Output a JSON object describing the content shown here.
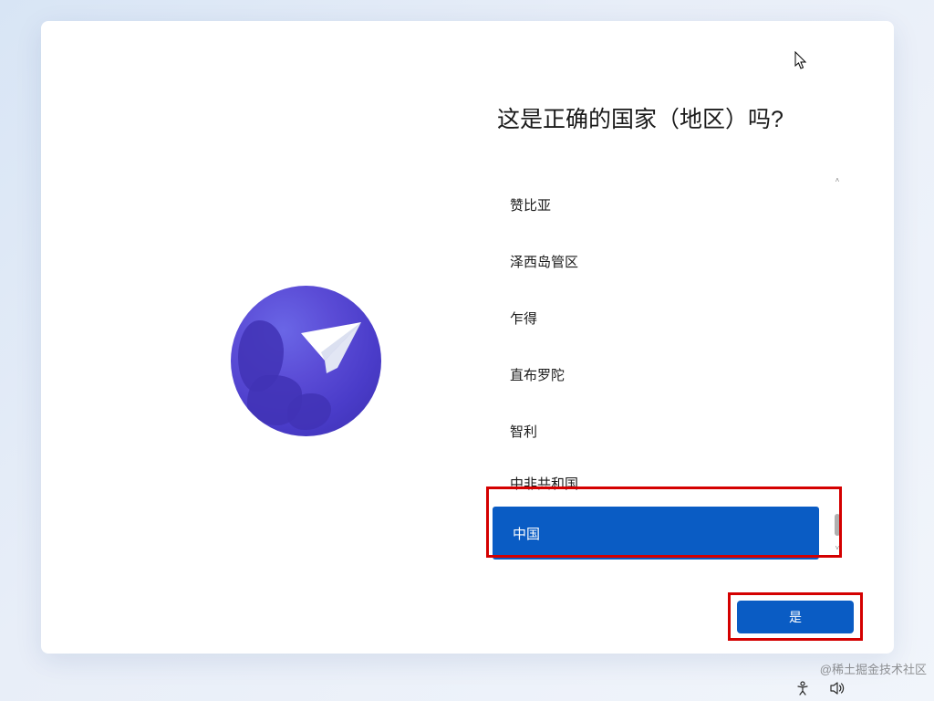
{
  "title": "这是正确的国家（地区）吗?",
  "countries": [
    {
      "label": "赞比亚",
      "selected": false
    },
    {
      "label": "泽西岛管区",
      "selected": false
    },
    {
      "label": "乍得",
      "selected": false
    },
    {
      "label": "直布罗陀",
      "selected": false
    },
    {
      "label": "智利",
      "selected": false
    },
    {
      "label": "中非共和国",
      "selected": false
    },
    {
      "label": "中国",
      "selected": true
    }
  ],
  "confirm_label": "是",
  "watermark": "@稀土掘金技术社区",
  "icons": {
    "globe": "globe-paper-plane",
    "accessibility": "accessibility-icon",
    "volume": "volume-icon"
  },
  "colors": {
    "accent": "#0a5cc4",
    "highlight": "#d40000"
  }
}
